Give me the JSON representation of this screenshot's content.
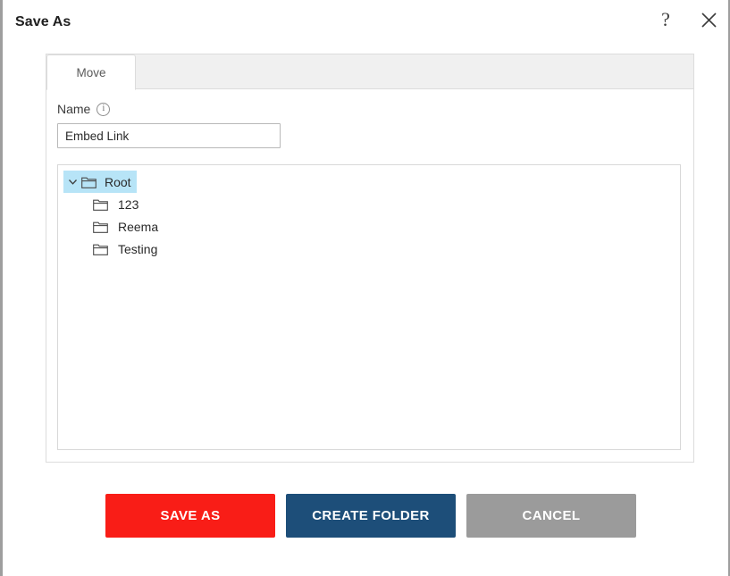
{
  "window": {
    "title": "Save As",
    "help_icon": "question-mark-icon",
    "close_icon": "close-icon"
  },
  "card": {
    "tab": {
      "label": "Move"
    },
    "name_field": {
      "label": "Name",
      "info_icon": "info-icon",
      "value": "Embed Link",
      "placeholder": ""
    },
    "tree": {
      "root": {
        "label": "Root",
        "icon": "folder-icon",
        "expanded": true,
        "selected": true,
        "chevron_icon": "chevron-down-icon"
      },
      "children": [
        {
          "label": "123",
          "icon": "folder-icon"
        },
        {
          "label": "Reema",
          "icon": "folder-icon"
        },
        {
          "label": "Testing",
          "icon": "folder-icon"
        }
      ]
    }
  },
  "footer": {
    "save_label": "SAVE AS",
    "create_label": "CREATE FOLDER",
    "cancel_label": "CANCEL"
  },
  "colors": {
    "save_red": "#f91d17",
    "create_blue": "#1d4e79",
    "cancel_gray": "#9b9b9b",
    "tree_selection": "#b7e4f7",
    "tab_strip": "#f0f0f0",
    "pattern_dot": "#b9c5ef"
  }
}
